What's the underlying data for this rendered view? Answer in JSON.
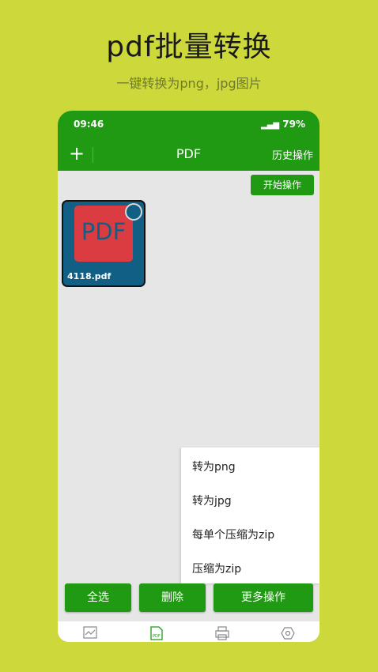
{
  "promo": {
    "title": "pdf批量转换",
    "subtitle": "一键转换为png，jpg图片"
  },
  "status_bar": {
    "time": "09:46",
    "battery": "79%"
  },
  "app_bar": {
    "add_icon": "plus-icon",
    "title": "PDF",
    "history_label": "历史操作"
  },
  "toolbar": {
    "start_label": "开始操作"
  },
  "files": [
    {
      "name": "4118.pdf",
      "icon_text": "PDF",
      "selected": true
    }
  ],
  "more_menu": {
    "items": [
      "转为png",
      "转为jpg",
      "每单个压缩为zip",
      "压缩为zip"
    ]
  },
  "actions": {
    "select_all": "全选",
    "delete": "删除",
    "more": "更多操作"
  },
  "bottom_nav": {
    "items": [
      "image-icon",
      "pdf-icon",
      "word-icon",
      "settings-icon"
    ]
  },
  "colors": {
    "background": "#cdd93a",
    "primary": "#1f9a12",
    "card": "#125f86",
    "pdf_red": "#db3c41"
  }
}
